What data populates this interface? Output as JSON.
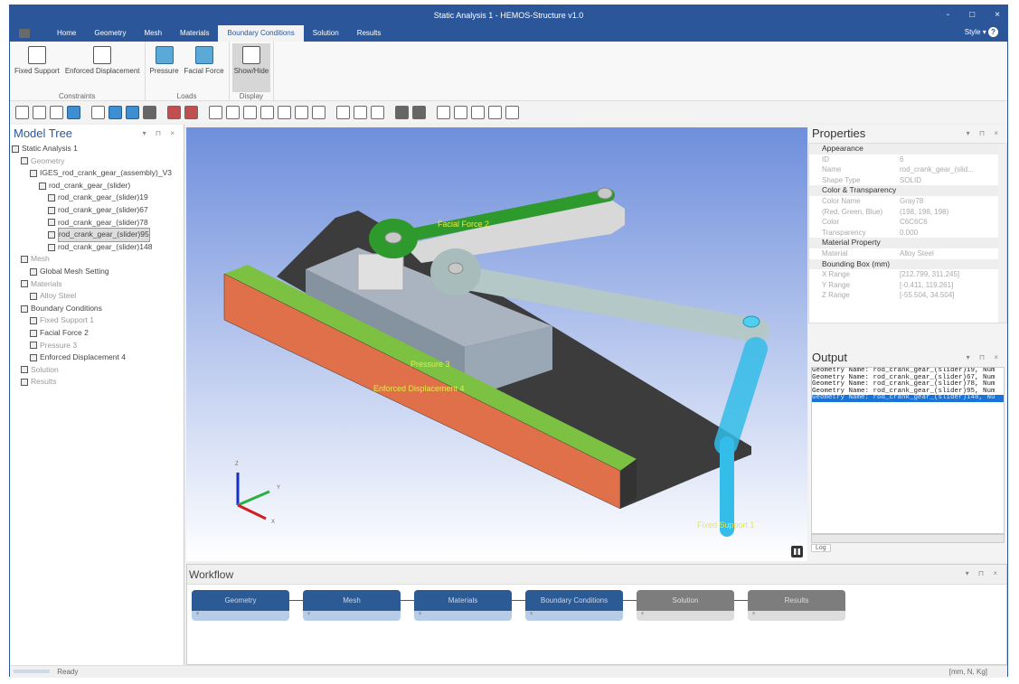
{
  "window": {
    "title": "Static Analysis 1 - HEMOS-Structure v1.0",
    "minimize": "-",
    "maximize": "□",
    "close": "×"
  },
  "tabs": [
    "Home",
    "Geometry",
    "Mesh",
    "Materials",
    "Boundary Conditions",
    "Solution",
    "Results"
  ],
  "active_tab": "Boundary Conditions",
  "style_label": "Style",
  "help": "?",
  "ribbon": {
    "groups": [
      {
        "label": "Constraints",
        "buttons": [
          "Fixed Support",
          "Enforced Displacement"
        ]
      },
      {
        "label": "Loads",
        "buttons": [
          "Pressure",
          "Facial Force"
        ]
      },
      {
        "label": "Display",
        "buttons": [
          "Show/Hide"
        ]
      }
    ]
  },
  "toolbar": {
    "icons": [
      "view-iso-icon",
      "view-front-icon",
      "view-select-icon",
      "view-blue-icon",
      "wireframe-icon",
      "shaded-icon",
      "shaded-edges-icon",
      "hidden-line-icon",
      "color-green-icon",
      "color-red-icon",
      "axis-icon",
      "view-xplus-icon",
      "view-xminus-icon",
      "view-yplus-icon",
      "view-yminus-icon",
      "view-zplus-icon",
      "view-zminus-icon",
      "zoom-fit-icon",
      "zoom-in-icon",
      "zoom-out-icon",
      "solid-icon",
      "transparent-icon",
      "rotate-cw-icon",
      "rotate-ccw-icon",
      "triad-icon",
      "measure-icon",
      "clipboard-icon"
    ]
  },
  "model_tree": {
    "title": "Model Tree",
    "nodes": [
      {
        "label": "Static Analysis 1",
        "level": 0,
        "dim": false
      },
      {
        "label": "Geometry",
        "level": 1,
        "dim": true
      },
      {
        "label": "IGES_rod_crank_gear_(assembly)_V3",
        "level": 2,
        "dim": false
      },
      {
        "label": "rod_crank_gear_(slider)",
        "level": 3,
        "dim": false
      },
      {
        "label": "rod_crank_gear_(slider)19",
        "level": 4,
        "dim": false
      },
      {
        "label": "rod_crank_gear_(slider)67",
        "level": 4,
        "dim": false
      },
      {
        "label": "rod_crank_gear_(slider)78",
        "level": 4,
        "dim": false
      },
      {
        "label": "rod_crank_gear_(slider)95",
        "level": 4,
        "dim": false,
        "selected": true
      },
      {
        "label": "rod_crank_gear_(slider)148",
        "level": 4,
        "dim": false
      },
      {
        "label": "Mesh",
        "level": 1,
        "dim": true
      },
      {
        "label": "Global Mesh Setting",
        "level": 2,
        "dim": false
      },
      {
        "label": "Materials",
        "level": 1,
        "dim": true
      },
      {
        "label": "Alloy Steel",
        "level": 2,
        "dim": true
      },
      {
        "label": "Boundary Conditions",
        "level": 1,
        "dim": false
      },
      {
        "label": "Fixed Support 1",
        "level": 2,
        "dim": true
      },
      {
        "label": "Facial Force 2",
        "level": 2,
        "dim": false
      },
      {
        "label": "Pressure 3",
        "level": 2,
        "dim": true
      },
      {
        "label": "Enforced Displacement 4",
        "level": 2,
        "dim": false
      },
      {
        "label": "Solution",
        "level": 1,
        "dim": true
      },
      {
        "label": "Results",
        "level": 1,
        "dim": true
      }
    ]
  },
  "viewport": {
    "labels": {
      "facial_force": "Facial Force 2",
      "pressure": "Pressure 3",
      "enforced": "Enforced Displacement 4",
      "fixed": "Fixed Support 1"
    },
    "axes": {
      "x": "X",
      "y": "Y",
      "z": "Z"
    },
    "colors": {
      "background_top": "#6f8fdc",
      "background_bottom": "#ffffff",
      "orange": "#e0704a",
      "green": "#2e9a2e",
      "rail_green": "#7cc142",
      "base": "#3c3c3c",
      "block": "#9aa7b5",
      "arm": "#b4c8c8",
      "link": "#33bde8"
    }
  },
  "properties": {
    "title": "Properties",
    "categories": [
      {
        "name": "Appearance",
        "rows": [
          [
            "ID",
            "6"
          ],
          [
            "Name",
            "rod_crank_gear_(slid..."
          ],
          [
            "Shape Type",
            "SOLID"
          ]
        ]
      },
      {
        "name": "Color & Transparency",
        "rows": [
          [
            "Color Name",
            "Gray78"
          ],
          [
            "(Red, Green, Blue)",
            "(198, 198, 198)"
          ],
          [
            "Color",
            "C6C6C6"
          ],
          [
            "Transparency",
            "0.000"
          ]
        ]
      },
      {
        "name": "Material Property",
        "rows": [
          [
            "Material",
            "Alloy Steel"
          ]
        ]
      },
      {
        "name": "Bounding Box (mm)",
        "rows": [
          [
            "X Range",
            "[212.799, 311.245]"
          ],
          [
            "Y Range",
            "[-0.411, 119.261]"
          ],
          [
            "Z Range",
            "[-55.504, 34.504]"
          ]
        ]
      }
    ]
  },
  "output": {
    "title": "Output",
    "lines": [
      "Geometry Name: rod_crank_gear_(slider)19, Num",
      "Geometry Name: rod_crank_gear_(slider)67, Num",
      "Geometry Name: rod_crank_gear_(slider)78, Num",
      "Geometry Name: rod_crank_gear_(slider)95, Num",
      "Geometry Name: rod_crank_gear_(slider)148, Nu"
    ],
    "selected_line": 4,
    "tab": "Log"
  },
  "workflow": {
    "title": "Workflow",
    "steps": [
      {
        "label": "Geometry",
        "done": true
      },
      {
        "label": "Mesh",
        "done": true
      },
      {
        "label": "Materials",
        "done": true
      },
      {
        "label": "Boundary Conditions",
        "done": true
      },
      {
        "label": "Solution",
        "done": false
      },
      {
        "label": "Results",
        "done": false
      }
    ]
  },
  "status": {
    "text": "Ready",
    "units": "[mm, N, Kg]"
  }
}
